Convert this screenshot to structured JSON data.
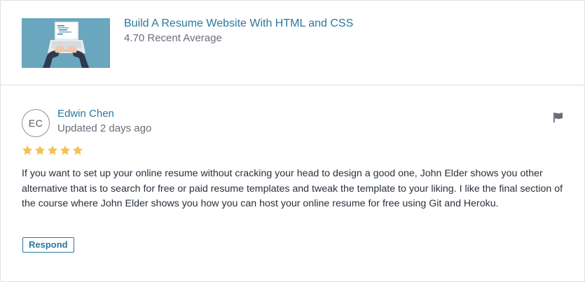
{
  "course": {
    "title": "Build A Resume Website With HTML and CSS",
    "rating_text": "4.70 Recent Average",
    "thumbnail_icon": "laptop-typing-illustration",
    "thumbnail_bg": "#6aa6bd"
  },
  "review": {
    "avatar_initials": "EC",
    "reviewer_name": "Edwin Chen",
    "updated_text": "Updated 2 days ago",
    "rating": 5,
    "max_rating": 5,
    "star_color": "#f4c150",
    "flag_icon": "flag-icon",
    "body": "If you want to set up your online resume without cracking your head to design a good one, John Elder shows you other alternative that is to search for free or paid resume templates and tweak the template to your liking. I like the final section of the course where John Elder shows you how you can host your online resume for free using Git and Heroku.",
    "respond_label": "Respond"
  },
  "colors": {
    "link": "#29789e",
    "muted": "#686f7a",
    "text": "#29303b",
    "border": "#dedfe0"
  }
}
